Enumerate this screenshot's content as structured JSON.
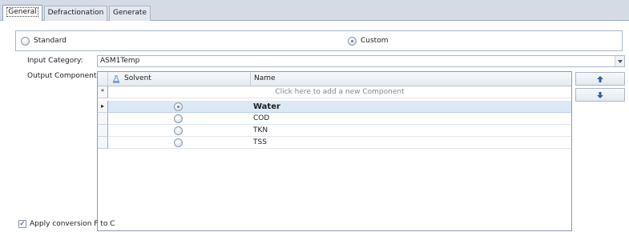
{
  "tabs": [
    {
      "label": "General"
    },
    {
      "label": "Defractionation"
    },
    {
      "label": "Generate"
    }
  ],
  "radio_group": {
    "standard_label": "Standard",
    "custom_label": "Custom",
    "selected": "Custom"
  },
  "form": {
    "input_category_label": "Input Category:",
    "input_category_value": "ASM1Temp",
    "output_components_label": "Output Components:"
  },
  "grid": {
    "columns": [
      "Solvent",
      "Name"
    ],
    "new_row_text": "Click here to add a new Component",
    "new_row_indicator": "*",
    "current_row_indicator": "▸",
    "rows": [
      {
        "solvent": true,
        "name": "Water"
      },
      {
        "solvent": false,
        "name": "COD"
      },
      {
        "solvent": false,
        "name": "TKN"
      },
      {
        "solvent": false,
        "name": "TSS"
      }
    ]
  },
  "buttons": {
    "move_up_icon": "arrow-up-icon",
    "move_down_icon": "arrow-down-icon"
  },
  "checkbox": {
    "label": "Apply conversion F to C",
    "checked": true,
    "mark": "✓"
  },
  "colors": {
    "tab_strip": "#d4dbe5",
    "selected_row": "#dde8f5",
    "button_arrow": "#3b5e91"
  }
}
